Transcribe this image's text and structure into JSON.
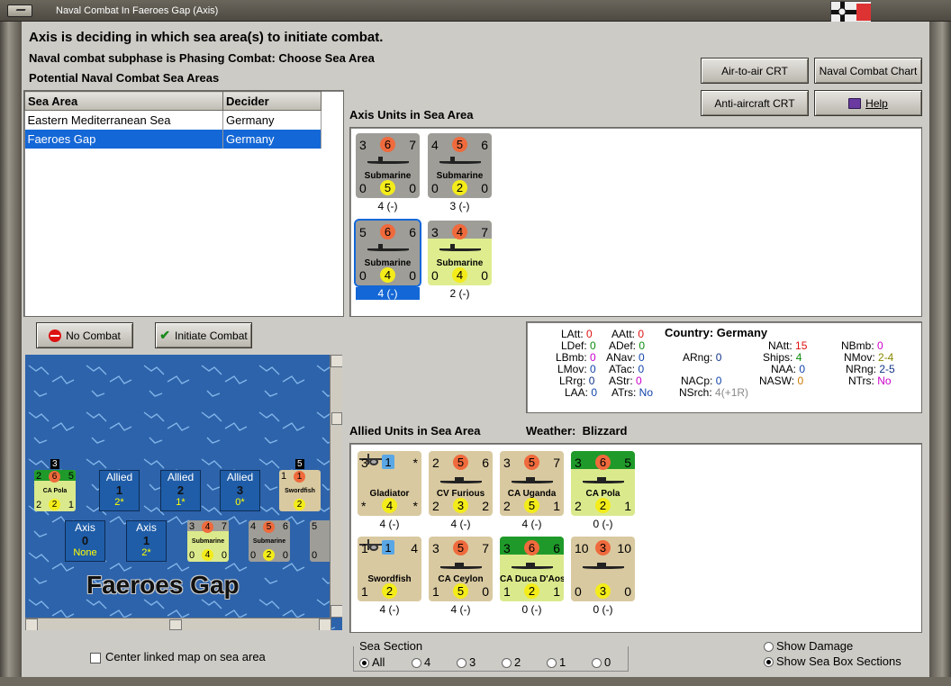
{
  "window": {
    "title": "Naval Combat In Faeroes Gap (Axis)"
  },
  "header": {
    "line1": "Axis is deciding in which sea area(s) to initiate combat.",
    "line2": "Naval combat subphase is Phasing Combat: Choose Sea Area",
    "line3": "Potential Naval Combat Sea Areas"
  },
  "buttons": {
    "air_crt": "Air-to-air CRT",
    "naval_chart": "Naval Combat Chart",
    "aa_crt": "Anti-aircraft CRT",
    "help": "Help",
    "no_combat": "No Combat",
    "initiate": "Initiate Combat"
  },
  "sea_table": {
    "col_area": "Sea Area",
    "col_decider": "Decider",
    "rows": [
      {
        "area": "Eastern Mediterranean Sea",
        "decider": "Germany"
      },
      {
        "area": "Faeroes Gap",
        "decider": "Germany"
      }
    ]
  },
  "axis_units": {
    "title": "Axis Units in Sea Area",
    "units": [
      {
        "tl": "3",
        "tm": "6",
        "tr": "7",
        "name": "Submarine",
        "bl": "0",
        "bm": "5",
        "br": "0",
        "below": "4 (-)"
      },
      {
        "tl": "4",
        "tm": "5",
        "tr": "6",
        "name": "Submarine",
        "bl": "0",
        "bm": "2",
        "br": "0",
        "below": "3 (-)"
      },
      {
        "tl": "5",
        "tm": "6",
        "tr": "6",
        "name": "Submarine",
        "bl": "0",
        "bm": "4",
        "br": "0",
        "below": "4 (-)"
      },
      {
        "tl": "3",
        "tm": "4",
        "tr": "7",
        "name": "Submarine",
        "bl": "0",
        "bm": "4",
        "br": "0",
        "below": "2 (-)"
      }
    ]
  },
  "stats": {
    "latt_l": "LAtt:",
    "latt": "0",
    "ldef_l": "LDef:",
    "ldef": "0",
    "lbmb_l": "LBmb:",
    "lbmb": "0",
    "lmov_l": "LMov:",
    "lmov": "0",
    "lrg_l": "LRrg:",
    "lrg": "0",
    "laa_l": "LAA:",
    "laa": "0",
    "aatt_l": "AAtt:",
    "aatt": "0",
    "adef_l": "ADef:",
    "adef": "0",
    "anav_l": "ANav:",
    "anav": "0",
    "atac_l": "ATac:",
    "atac": "0",
    "astr_l": "AStr:",
    "astr": "0",
    "atrs_l": "ATrs:",
    "atrs": "No",
    "country_l": "Country:",
    "country": "Germany",
    "arng_l": "ARng:",
    "arng": "0",
    "nacp_l": "NACp:",
    "nacp": "0",
    "nsrch_l": "NSrch:",
    "nsrch": "4(+1R)",
    "natt_l": "NAtt:",
    "natt": "15",
    "ships_l": "Ships:",
    "ships": "4",
    "naa_l": "NAA:",
    "naa": "0",
    "nasw_l": "NASW:",
    "nasw": "0",
    "nbmb_l": "NBmb:",
    "nbmb": "0",
    "nmov_l": "NMov:",
    "nmov": "2-4",
    "nrng_l": "NRng:",
    "nrng": "2-5",
    "ntrs_l": "NTrs:",
    "ntrs": "No"
  },
  "allied_units": {
    "title": "Allied Units in Sea Area",
    "weather_l": "Weather:",
    "weather": "Blizzard",
    "units": [
      {
        "tl": "3",
        "tm": "1",
        "tr": "*",
        "name": "Gladiator",
        "bl": "*",
        "bm": "4",
        "br": "*",
        "below": "4 (-)"
      },
      {
        "tl": "2",
        "tm": "5",
        "tr": "6",
        "name": "CV Furious",
        "bl": "2",
        "bm": "3",
        "br": "2",
        "below": "4 (-)"
      },
      {
        "tl": "3",
        "tm": "5",
        "tr": "7",
        "name": "CA Uganda",
        "bl": "2",
        "bm": "5",
        "br": "1",
        "below": "4 (-)"
      },
      {
        "tl": "3",
        "tm": "6",
        "tr": "5",
        "name": "CA Pola",
        "bl": "2",
        "bm": "2",
        "br": "1",
        "below": "0 (-)"
      },
      {
        "tl": "1",
        "tm": "1",
        "tr": "4",
        "name": "Swordfish",
        "bl": "1",
        "bm": "2",
        "br": "",
        "below": "4 (-)"
      },
      {
        "tl": "3",
        "tm": "5",
        "tr": "7",
        "name": "CA Ceylon",
        "bl": "1",
        "bm": "5",
        "br": "0",
        "below": "4 (-)"
      },
      {
        "tl": "3",
        "tm": "6",
        "tr": "6",
        "name": "CA Duca D'Aosta",
        "bl": "1",
        "bm": "2",
        "br": "1",
        "below": "0 (-)"
      },
      {
        "tl": "10",
        "tm": "3",
        "tr": "10",
        "name": "",
        "bl": "0",
        "bm": "3",
        "br": "0",
        "below": "0 (-)"
      }
    ]
  },
  "map": {
    "sea_name": "Faeroes Gap",
    "boxes": [
      {
        "side": "Allied",
        "n": "1",
        "v": "2*"
      },
      {
        "side": "Allied",
        "n": "2",
        "v": "1*"
      },
      {
        "side": "Allied",
        "n": "3",
        "v": "0*"
      },
      {
        "side": "Axis",
        "n": "0",
        "v": "None"
      },
      {
        "side": "Axis",
        "n": "1",
        "v": "2*"
      }
    ],
    "pola": {
      "stack": "3",
      "tl": "2",
      "tm": "6",
      "tr": "5",
      "name": "CA Pola",
      "bl": "2",
      "bm": "2",
      "br": "1"
    },
    "sword": {
      "stack": "5",
      "tl": "1",
      "tm": "1",
      "name": "Swordfish",
      "bm": "2"
    },
    "sub1": {
      "tl": "3",
      "tm": "4",
      "tr": "7",
      "name": "Submarine",
      "bl": "0",
      "bm": "4",
      "br": "0"
    },
    "sub2": {
      "tl": "4",
      "tm": "5",
      "tr": "6",
      "name": "Submarine",
      "bl": "0",
      "bm": "2",
      "br": "0"
    },
    "sub3": {
      "tl": "5",
      "bl": "0"
    }
  },
  "options": {
    "center_map": "Center linked map on sea area",
    "sea_section": "Sea Section",
    "sections": [
      "All",
      "4",
      "3",
      "2",
      "1",
      "0"
    ],
    "show_damage": "Show Damage",
    "show_sections": "Show Sea Box Sections"
  }
}
